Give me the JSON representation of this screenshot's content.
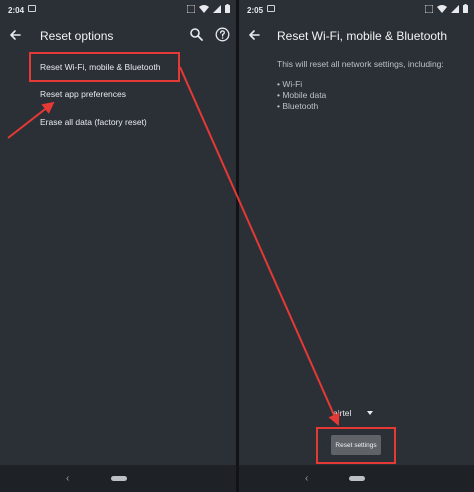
{
  "left_screen": {
    "status_time": "2:04",
    "title": "Reset options",
    "menu_items": [
      "Reset Wi-Fi, mobile & Bluetooth",
      "Reset app preferences",
      "Erase all data (factory reset)"
    ],
    "icons": {
      "back": "arrow-left-icon",
      "search": "search-icon",
      "help": "help-circle-icon"
    }
  },
  "right_screen": {
    "status_time": "2:05",
    "title": "Reset Wi-Fi, mobile & Bluetooth",
    "description": "This will reset all network settings, including:",
    "bullets": [
      "• Wi-Fi",
      "• Mobile data",
      "• Bluetooth"
    ],
    "carrier": "airtel",
    "reset_button": "Reset settings",
    "icons": {
      "back": "arrow-left-icon"
    }
  },
  "nav_bar": {
    "back_glyph": "‹"
  },
  "colors": {
    "background": "#2b3036",
    "annotation": "#e53935",
    "button": "#5f6368"
  }
}
